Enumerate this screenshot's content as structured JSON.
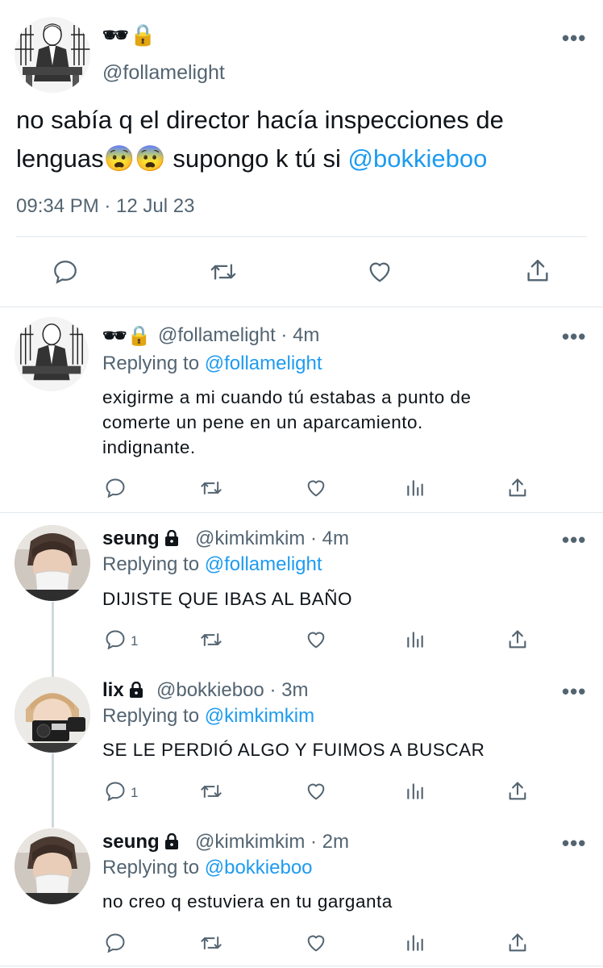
{
  "main_tweet": {
    "display_name": "🕶🔒",
    "handle": "@follamelight",
    "text_part1": "no sabía q el director hacía inspecciones de lenguas😨😨  supongo k tú si ",
    "mention": "@bokkieboo",
    "timestamp": "09:34 PM · 12 Jul 23",
    "more_label": "•••"
  },
  "replies": [
    {
      "display_name": "🕶🔒",
      "handle_time": "@follamelight · 4m",
      "replying_prefix": "Replying to ",
      "replying_to": "@follamelight",
      "text_lines": [
        "exigirme a mi cuando tú estabas a punto de",
        "comerte un pene en un aparcamiento.",
        "indignante."
      ],
      "reply_count": ""
    },
    {
      "display_name": "seung",
      "handle_time": "@kimkimkim · 4m",
      "replying_prefix": "Replying to ",
      "replying_to": "@follamelight",
      "text_lines": [
        "DIJISTE QUE IBAS AL BAÑO"
      ],
      "reply_count": "1"
    },
    {
      "display_name": "lix",
      "handle_time": "@bokkieboo · 3m",
      "replying_prefix": "Replying to ",
      "replying_to": "@kimkimkim",
      "text_lines": [
        "SE LE PERDIÓ ALGO Y FUIMOS A BUSCAR"
      ],
      "reply_count": "1"
    },
    {
      "display_name": "seung",
      "handle_time": "@kimkimkim · 2m",
      "replying_prefix": "Replying to ",
      "replying_to": "@bokkieboo",
      "text_lines": [
        "no creo q estuviera en tu garganta"
      ],
      "reply_count": ""
    }
  ],
  "colors": {
    "link": "#1d9bf0",
    "secondary": "#536471",
    "text": "#0f1419",
    "divider": "#e1e8ed"
  },
  "icons": [
    "reply-icon",
    "retweet-icon",
    "like-icon",
    "share-icon",
    "analytics-icon",
    "lock-icon",
    "more-icon"
  ]
}
